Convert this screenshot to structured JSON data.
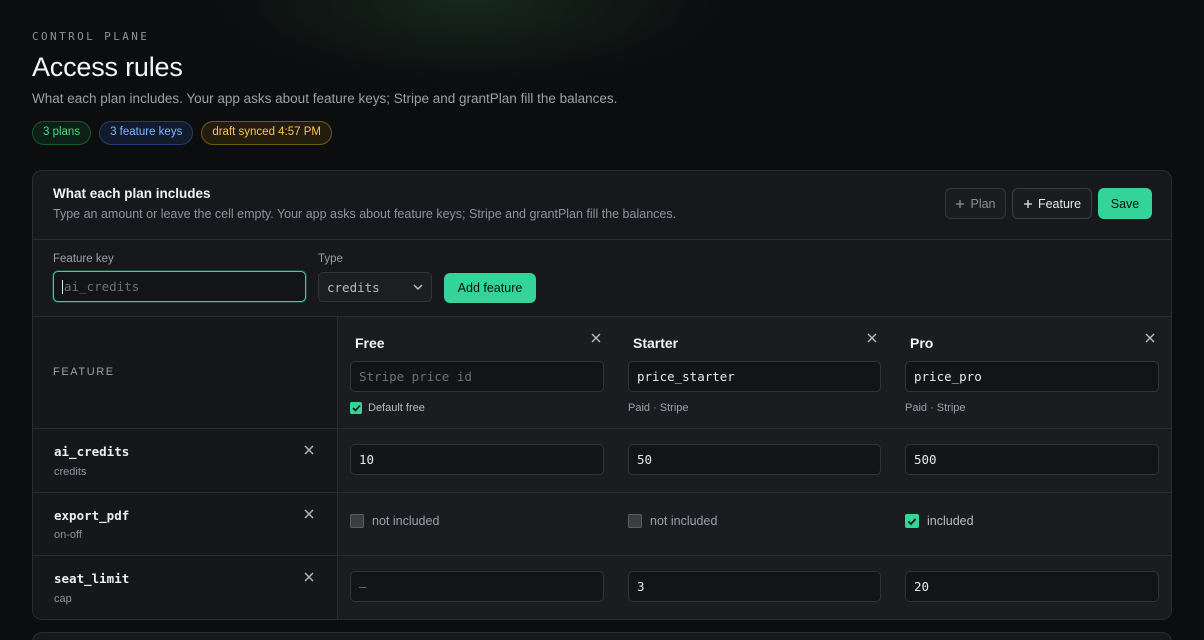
{
  "header": {
    "eyebrow": "CONTROL PLANE",
    "title": "Access rules",
    "subtitle": "What each plan includes. Your app asks about feature keys; Stripe and grantPlan fill the balances.",
    "badges": [
      {
        "label": "3 plans",
        "tone": "#4ade80"
      },
      {
        "label": "3 feature keys",
        "tone": "#7fb6ff"
      },
      {
        "label": "draft synced 4:57 PM",
        "tone": "#f5c451"
      }
    ]
  },
  "card": {
    "title": "What each plan includes",
    "subtitle": "Type an amount or leave the cell empty. Your app asks about feature keys; Stripe and grantPlan fill the balances.",
    "actions": {
      "plan": "Plan",
      "feature": "Feature",
      "save": "Save"
    }
  },
  "add_feature": {
    "key_label": "Feature key",
    "key_placeholder": "ai_credits",
    "type_label": "Type",
    "type_value": "credits",
    "button": "Add feature"
  },
  "table": {
    "feature_header": "FEATURE",
    "plans": [
      {
        "name": "Free",
        "price_id": "",
        "price_placeholder": "Stripe price id",
        "note": "Default free",
        "default_checked": true
      },
      {
        "name": "Starter",
        "price_id": "price_starter",
        "price_placeholder": "",
        "note": "Paid · Stripe"
      },
      {
        "name": "Pro",
        "price_id": "price_pro",
        "price_placeholder": "",
        "note": "Paid · Stripe"
      }
    ],
    "rows": [
      {
        "key": "ai_credits",
        "type": "credits",
        "values": [
          "10",
          "50",
          "500"
        ]
      },
      {
        "key": "export_pdf",
        "type": "on-off",
        "values": [
          "not included",
          "not included",
          "included"
        ],
        "checked": [
          false,
          false,
          true
        ]
      },
      {
        "key": "seat_limit",
        "type": "cap",
        "values": [
          "",
          "3",
          "20"
        ],
        "placeholder": "—"
      }
    ]
  },
  "colors": {
    "accent": "#34d399",
    "background": "#0c0d0f",
    "card": "#17181b"
  }
}
